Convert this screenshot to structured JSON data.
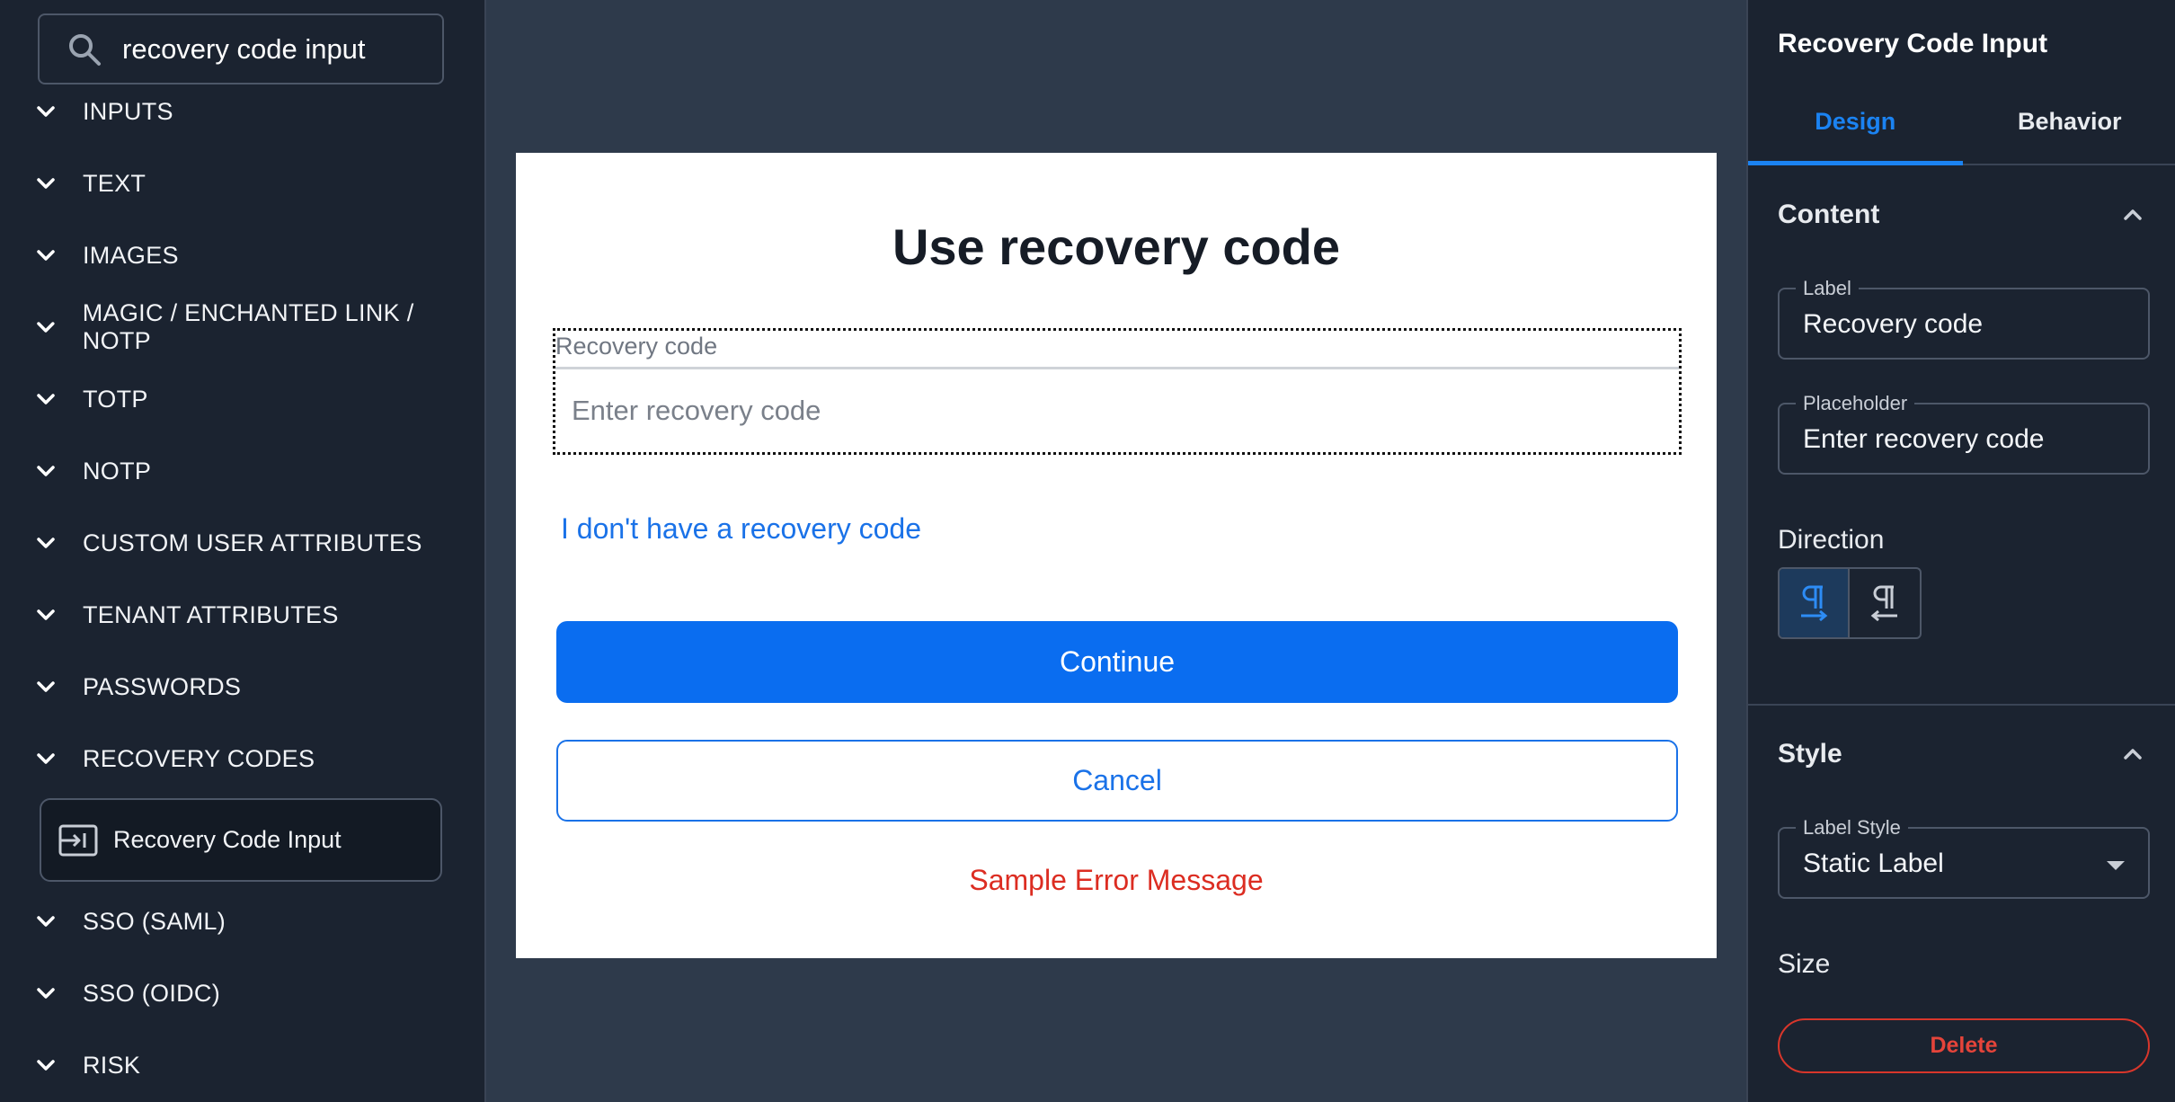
{
  "sidebar": {
    "search": {
      "value": "recovery code input",
      "icon": "search-icon"
    },
    "groups": [
      {
        "label": "INPUTS"
      },
      {
        "label": "TEXT"
      },
      {
        "label": "IMAGES"
      },
      {
        "label": "MAGIC / ENCHANTED LINK / NOTP"
      },
      {
        "label": "TOTP"
      },
      {
        "label": "NOTP"
      },
      {
        "label": "CUSTOM USER ATTRIBUTES"
      },
      {
        "label": "TENANT ATTRIBUTES"
      },
      {
        "label": "PASSWORDS"
      },
      {
        "label": "RECOVERY CODES"
      },
      {
        "label": "SSO (SAML)"
      },
      {
        "label": "SSO (OIDC)"
      },
      {
        "label": "RISK"
      }
    ],
    "recovery_child": {
      "label": "Recovery Code Input",
      "icon": "input-component-icon"
    }
  },
  "canvas": {
    "title": "Use recovery code",
    "field_label": "Recovery code",
    "field_placeholder": "Enter recovery code",
    "link": "I don't have a recovery code",
    "continue": "Continue",
    "cancel": "Cancel",
    "error": "Sample Error Message"
  },
  "panel": {
    "title": "Recovery Code Input",
    "tabs": {
      "design": "Design",
      "behavior": "Behavior"
    },
    "content": {
      "title": "Content",
      "label_legend": "Label",
      "label_value": "Recovery code",
      "placeholder_legend": "Placeholder",
      "placeholder_value": "Enter recovery code",
      "direction": "Direction"
    },
    "style": {
      "title": "Style",
      "label_style_legend": "Label Style",
      "label_style_value": "Static Label",
      "size": "Size"
    },
    "delete": "Delete"
  },
  "colors": {
    "accent": "#0a6df0",
    "error": "#dc2d22",
    "panel_bg": "#1b2330",
    "canvas_bg": "#2e3a4b"
  }
}
